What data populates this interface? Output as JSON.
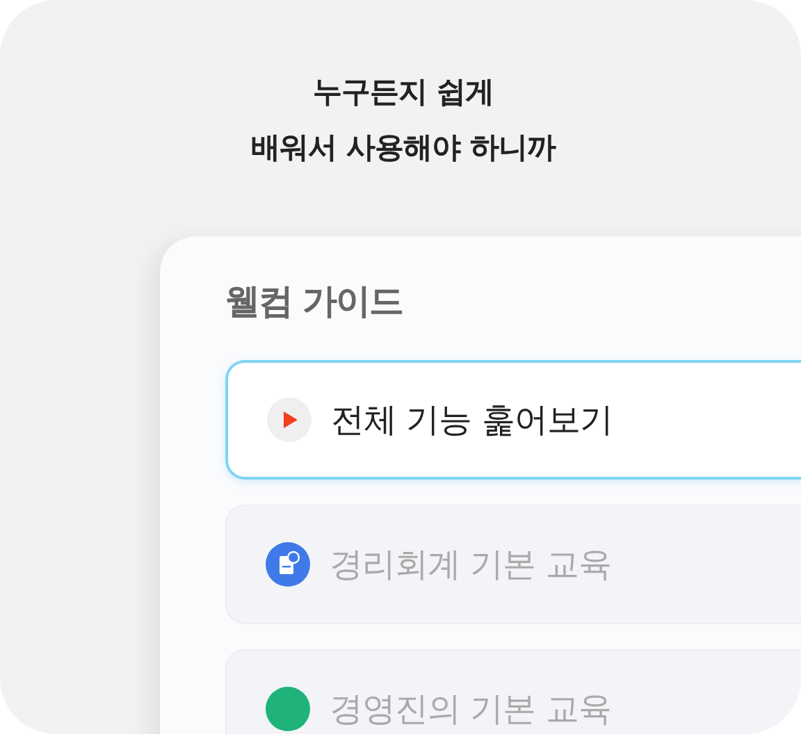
{
  "headline": [
    "누구든지 쉽게",
    "배워서 사용해야 하니까"
  ],
  "guide": {
    "title": "웰컴 가이드",
    "items": [
      {
        "label": "전체 기능 훑어보기",
        "kind": "play",
        "selected": true
      },
      {
        "label": "경리회계 기본 교육",
        "kind": "document",
        "selected": false
      },
      {
        "label": "경영진의 기본 교육",
        "kind": "green",
        "selected": false
      }
    ]
  }
}
